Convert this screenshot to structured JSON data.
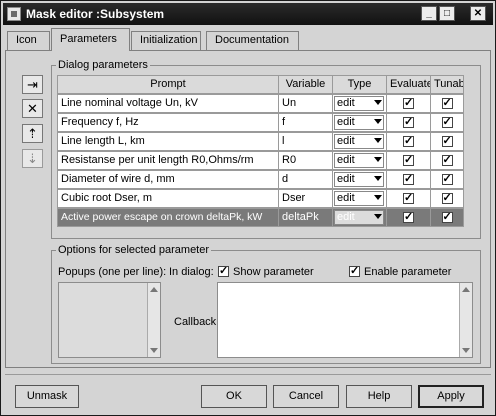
{
  "window": {
    "title": "Mask editor :Subsystem",
    "controls": [
      "_",
      "□",
      "✕"
    ]
  },
  "tabs": [
    {
      "label": "Icon",
      "active": false
    },
    {
      "label": "Parameters",
      "active": true
    },
    {
      "label": "Initialization",
      "active": false
    },
    {
      "label": "Documentation",
      "active": false
    }
  ],
  "side_buttons": [
    {
      "icon": "add-parameter-icon",
      "glyph": "⇥"
    },
    {
      "icon": "delete-icon",
      "glyph": "✕"
    },
    {
      "icon": "move-up-icon",
      "glyph": "⇡"
    },
    {
      "icon": "move-down-icon",
      "glyph": "⇣"
    }
  ],
  "dialog_parameters": {
    "legend": "Dialog parameters",
    "columns": [
      "Prompt",
      "Variable",
      "Type",
      "Evaluate",
      "Tunable"
    ],
    "rows": [
      {
        "prompt": "Line nominal voltage Un, kV",
        "variable": "Un",
        "type": "edit",
        "evaluate": true,
        "tunable": true
      },
      {
        "prompt": "Frequency f, Hz",
        "variable": "f",
        "type": "edit",
        "evaluate": true,
        "tunable": true
      },
      {
        "prompt": "Line length L, km",
        "variable": "l",
        "type": "edit",
        "evaluate": true,
        "tunable": true
      },
      {
        "prompt": "Resistanse per unit length R0,Ohms/rm",
        "variable": "R0",
        "type": "edit",
        "evaluate": true,
        "tunable": true
      },
      {
        "prompt": "Diameter of wire d, mm",
        "variable": "d",
        "type": "edit",
        "evaluate": true,
        "tunable": true
      },
      {
        "prompt": "Cubic root Dser, m",
        "variable": "Dser",
        "type": "edit",
        "evaluate": true,
        "tunable": true
      },
      {
        "prompt": "Active power escape on  crown deltaPk, kW",
        "variable": "deltaPk",
        "type": "edit",
        "evaluate": true,
        "tunable": true,
        "selected": true
      }
    ]
  },
  "options": {
    "legend": "Options for selected parameter",
    "popups_label": "Popups (one per line):",
    "in_dialog_label": "In dialog:",
    "show_parameter_label": "Show parameter",
    "show_parameter_checked": true,
    "enable_parameter_label": "Enable parameter",
    "enable_parameter_checked": true,
    "callback_label": "Callback:"
  },
  "footer": {
    "unmask": "Unmask",
    "ok": "OK",
    "cancel": "Cancel",
    "help": "Help",
    "apply": "Apply"
  }
}
